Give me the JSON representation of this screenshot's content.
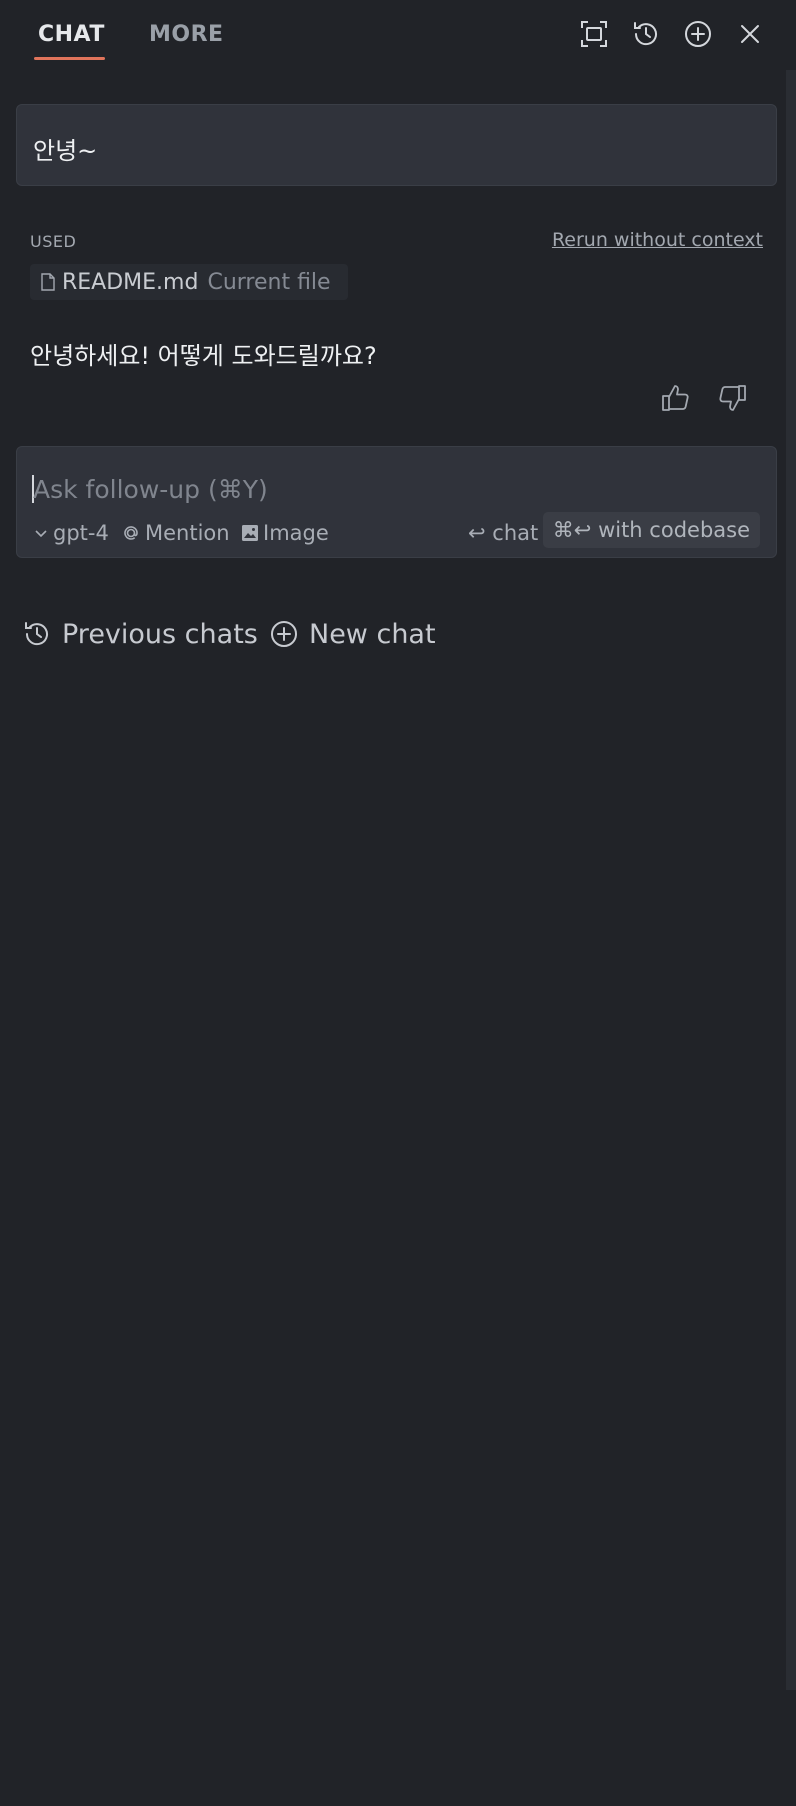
{
  "tabs": [
    {
      "label": "CHAT",
      "active": true
    },
    {
      "label": "MORE",
      "active": false
    }
  ],
  "toolbar_icons": [
    "maximize-icon",
    "history-icon",
    "add-icon",
    "close-icon"
  ],
  "conversation": {
    "user_message": "안녕~",
    "context": {
      "used_label": "USED",
      "rerun_label": "Rerun without context",
      "file_name": "README.md",
      "file_sub": "Current file"
    },
    "assistant_message": "안녕하세요! 어떻게 도와드릴까요?"
  },
  "input": {
    "placeholder": "Ask follow-up (⌘Y)",
    "value": "",
    "model": "gpt-4",
    "mention_label": "Mention",
    "image_label": "Image",
    "chat_shortcut": "↩ chat",
    "codebase_shortcut": "⌘↩ with codebase"
  },
  "bottom_links": {
    "previous_chats": "Previous chats",
    "new_chat": "New chat"
  },
  "colors": {
    "background": "#212328",
    "panel": "#30333b",
    "accent": "#e0745b"
  }
}
